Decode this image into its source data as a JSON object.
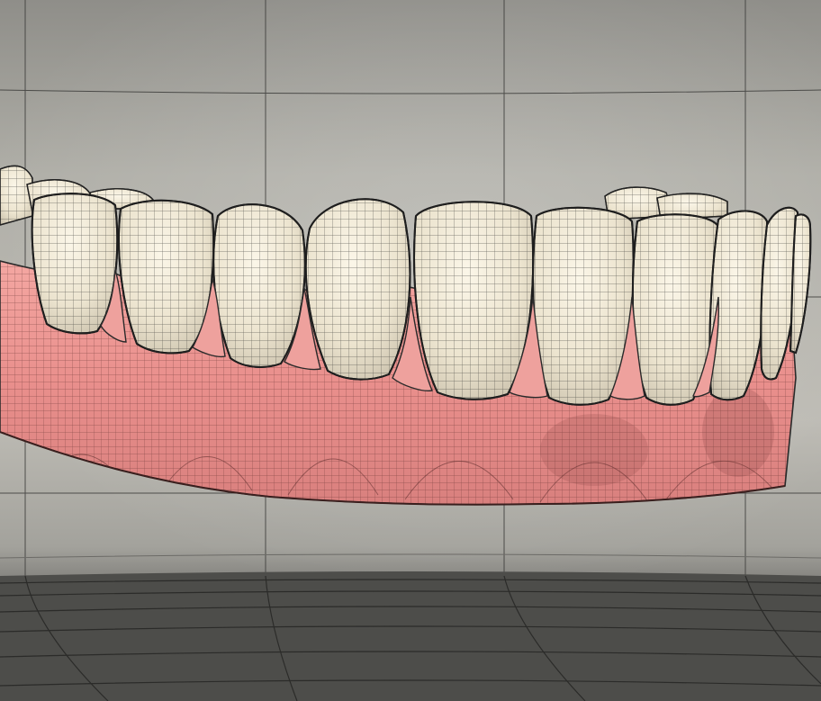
{
  "scene": {
    "subject": "denture-wireframe-render",
    "backdrop_color": "#b9b7b0",
    "floor_color": "#4f4f4c",
    "gum_color": "#e8908f",
    "tooth_color": "#ede6d2",
    "wire_color": "#2a2a2a",
    "tooth_count_visible": 10
  }
}
